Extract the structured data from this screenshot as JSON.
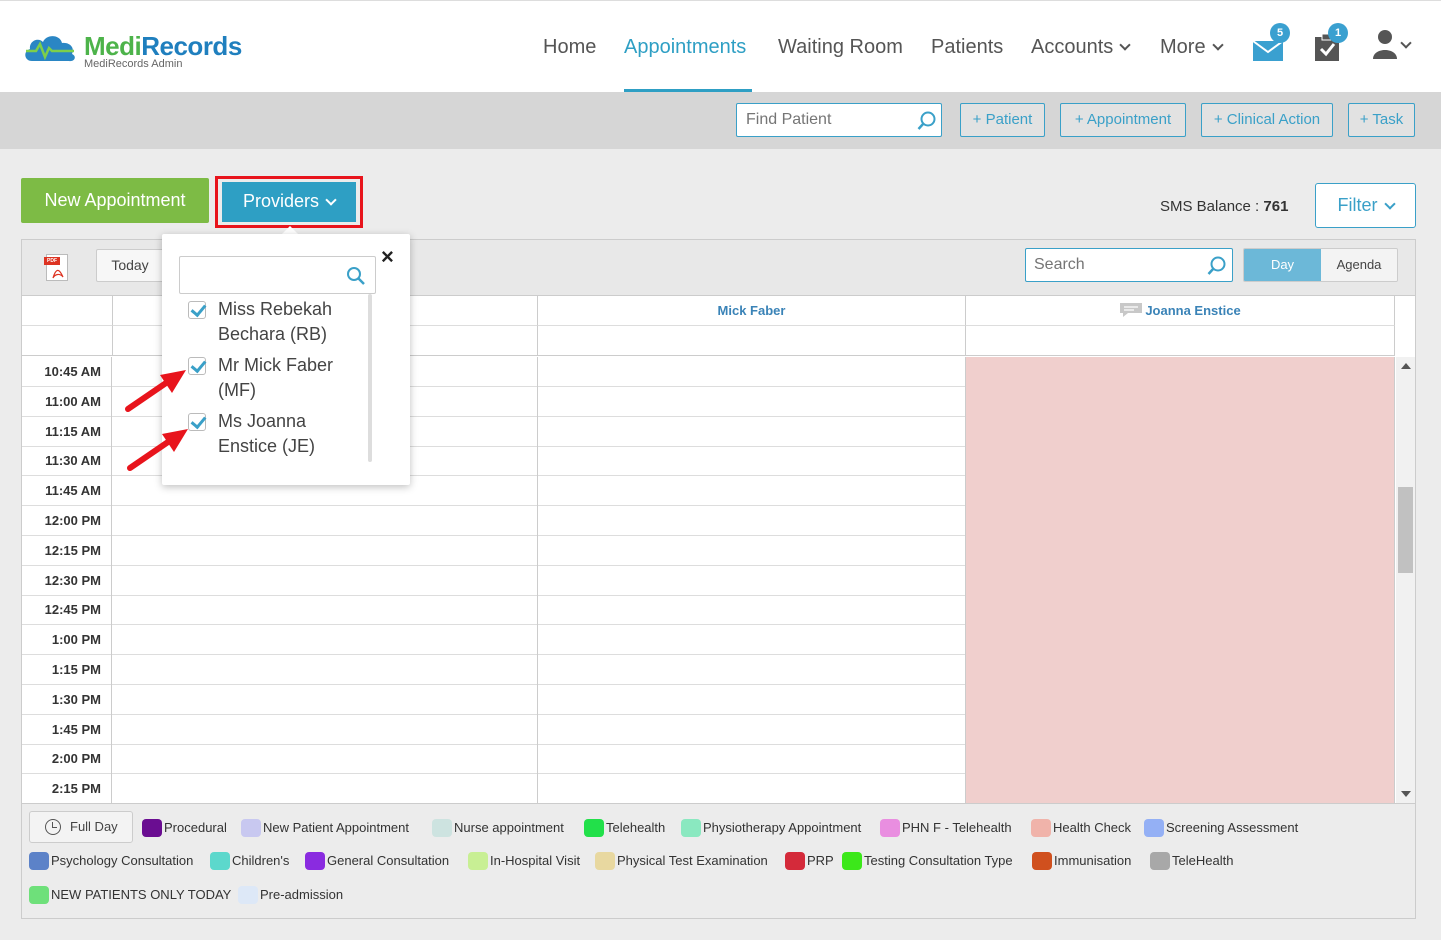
{
  "app": {
    "brand_medi": "Medi",
    "brand_records": "Records",
    "subtitle": "MediRecords Admin"
  },
  "nav": {
    "items": [
      {
        "label": "Home"
      },
      {
        "label": "Appointments"
      },
      {
        "label": "Waiting Room"
      },
      {
        "label": "Patients"
      },
      {
        "label": "Accounts"
      },
      {
        "label": "More"
      }
    ],
    "active": "Appointments",
    "mail_badge": "5",
    "tasks_badge": "1"
  },
  "actions": {
    "find_placeholder": "Find Patient",
    "add_patient": "+ Patient",
    "add_appointment": "+ Appointment",
    "add_clinical_action": "+ Clinical Action",
    "add_task": "+ Task"
  },
  "toolbar": {
    "new_appointment": "New Appointment",
    "providers": "Providers",
    "sms_label": "SMS Balance :",
    "sms_value": "761",
    "filter": "Filter"
  },
  "calendar": {
    "today": "Today",
    "search_placeholder": "Search",
    "view_day": "Day",
    "view_agenda": "Agenda",
    "columns": [
      "",
      "Mick Faber",
      "Joanna Enstice"
    ],
    "times": [
      "10:45 AM",
      "11:00 AM",
      "11:15 AM",
      "11:30 AM",
      "11:45 AM",
      "12:00 PM",
      "12:15 PM",
      "12:30 PM",
      "12:45 PM",
      "1:00 PM",
      "1:15 PM",
      "1:30 PM",
      "1:45 PM",
      "2:00 PM",
      "2:15 PM"
    ],
    "full_day": "Full Day"
  },
  "legend": [
    {
      "label": "Procedural",
      "color": "#6a0d91"
    },
    {
      "label": "New Patient Appointment",
      "color": "#c8c8f0"
    },
    {
      "label": "Nurse appointment",
      "color": "#cde3e0"
    },
    {
      "label": "Telehealth",
      "color": "#22e04a"
    },
    {
      "label": "Physiotherapy Appointment",
      "color": "#8ae8c0"
    },
    {
      "label": "PHN F - Telehealth",
      "color": "#e98ee0"
    },
    {
      "label": "Health Check",
      "color": "#f0b3aa"
    },
    {
      "label": "Screening Assessment",
      "color": "#94b0f5"
    },
    {
      "label": "Psychology Consultation",
      "color": "#5c82c8"
    },
    {
      "label": "Children's",
      "color": "#5cd8cc"
    },
    {
      "label": "General Consultation",
      "color": "#8a2be0"
    },
    {
      "label": "In-Hospital Visit",
      "color": "#c8ef94"
    },
    {
      "label": "Physical Test Examination",
      "color": "#e8d8a0"
    },
    {
      "label": "PRP",
      "color": "#d42a3a"
    },
    {
      "label": "Testing Consultation Type",
      "color": "#3ce81a"
    },
    {
      "label": "Immunisation",
      "color": "#d0501e"
    },
    {
      "label": "TeleHealth",
      "color": "#a8a8a8"
    },
    {
      "label": "NEW PATIENTS ONLY TODAY",
      "color": "#6ee07a"
    },
    {
      "label": "Pre-admission",
      "color": "#dde8f7"
    }
  ],
  "providers_dropdown": {
    "close": "×",
    "items": [
      {
        "label": "Miss Rebekah Bechara (RB)",
        "checked": true
      },
      {
        "label": "Mr Mick Faber (MF)",
        "checked": true
      },
      {
        "label": "Ms Joanna Enstice (JE)",
        "checked": true
      }
    ]
  },
  "colors": {
    "accent": "#2e9fc4",
    "green": "#7dbb45",
    "highlight_red": "#e8141c",
    "unavailable": "#f0cfcd"
  }
}
